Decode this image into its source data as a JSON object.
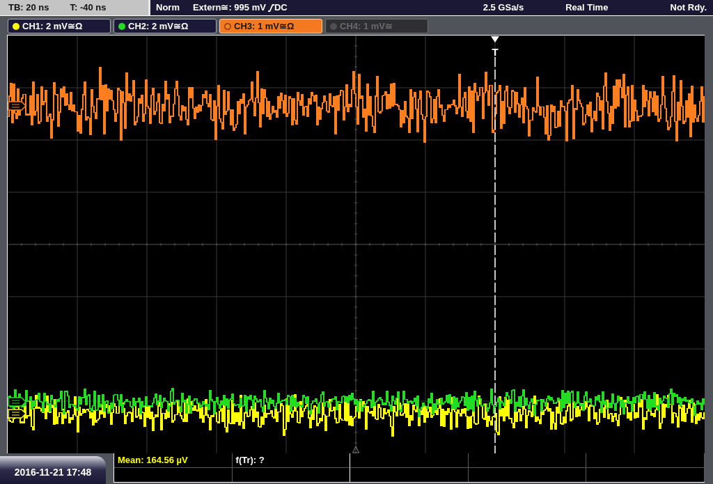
{
  "status_bar": {
    "timebase": "TB: 20 ns",
    "trigger_time": "T: -40 ns",
    "trigger_mode": "Norm",
    "trigger_source": "Extern≅: 995 mV",
    "trigger_coupling": "DC",
    "sample_rate": "2.5 GSa/s",
    "acquisition": "Real Time",
    "status": "Not Rdy."
  },
  "channels": [
    {
      "label": "CH1: 2 mV≅Ω",
      "color": "#ffff00",
      "selected": false,
      "enabled": true
    },
    {
      "label": "CH2: 2 mV≅Ω",
      "color": "#22dd22",
      "selected": false,
      "enabled": true
    },
    {
      "label": "CH3: 1 mV≅Ω",
      "color": "#ff7f1e",
      "selected": true,
      "enabled": true
    },
    {
      "label": "CH4: 1 mV≅",
      "color": "#505050",
      "selected": false,
      "enabled": false
    }
  ],
  "trigger_marker": "T",
  "datetime": "2016-11-21 17:48",
  "measurements": [
    {
      "label": "Mean: 164.56 µV",
      "color": "#ffff00"
    },
    {
      "label": "f(Tr): ?",
      "color": "#ffffff"
    }
  ]
}
